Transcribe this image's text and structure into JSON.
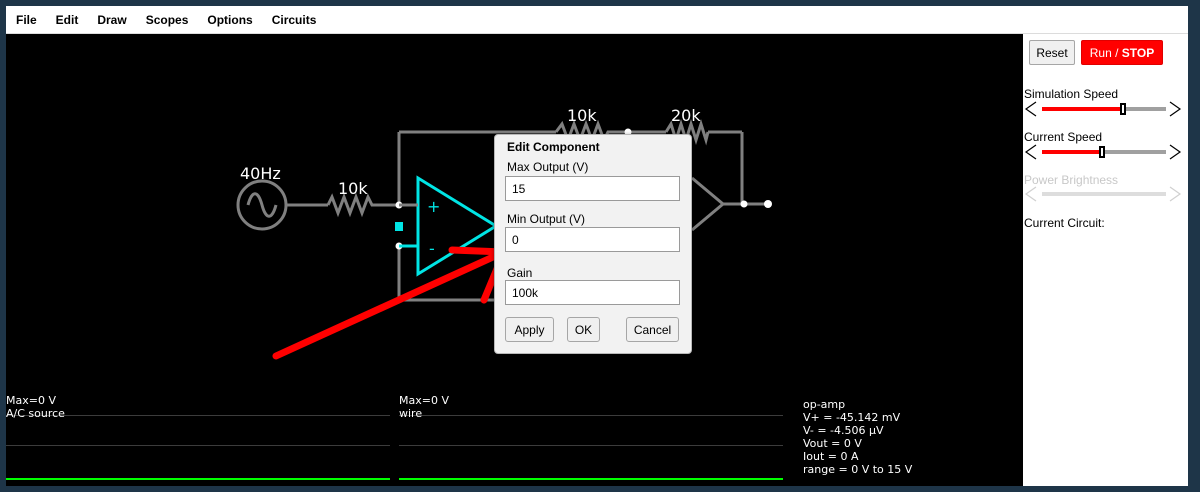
{
  "menu": [
    "File",
    "Edit",
    "Draw",
    "Scopes",
    "Options",
    "Circuits"
  ],
  "circuit": {
    "source_label": "40Hz",
    "input_resistor": "10k",
    "feedback_resistor_1": "10k",
    "feedback_resistor_2": "20k",
    "opamp_plus": "+",
    "opamp_minus": "-"
  },
  "dialog": {
    "title": "Edit Component",
    "fields": [
      {
        "label": "Max Output (V)",
        "value": "15"
      },
      {
        "label": "Min Output (V)",
        "value": "0"
      },
      {
        "label": "Gain",
        "value": "100k"
      }
    ],
    "buttons": {
      "apply": "Apply",
      "ok": "OK",
      "cancel": "Cancel"
    }
  },
  "sidebar": {
    "reset": "Reset",
    "run_prefix": "Run / ",
    "run_stop": "STOP",
    "simulation_speed": {
      "label": "Simulation Speed",
      "level": 0.67
    },
    "current_speed": {
      "label": "Current Speed",
      "level": 0.5
    },
    "power_brightness": {
      "label": "Power Brightness",
      "level": 0.0,
      "disabled": true
    },
    "current_circuit": "Current Circuit:",
    "left_arrow": "<",
    "right_arrow": ">"
  },
  "scopes": [
    {
      "max": "Max=0 V",
      "name": "A/C source"
    },
    {
      "max": "Max=0 V",
      "name": "wire"
    }
  ],
  "info": {
    "title": "op-amp",
    "lines": [
      "V+ = -45.142 mV",
      "V- = -4.506 µV",
      "Vout = 0 V",
      "Iout = 0 A",
      "range = 0 V to 15 V"
    ]
  },
  "colors": {
    "accent": "#ff0000",
    "opamp": "#00e5e5",
    "wire": "#808080",
    "trace": "#00ff00",
    "annotation_arrow": "#ff0000"
  },
  "icons": {
    "source": "ac-source-icon",
    "resistor": "resistor-icon",
    "opamp": "op-amp-icon"
  }
}
